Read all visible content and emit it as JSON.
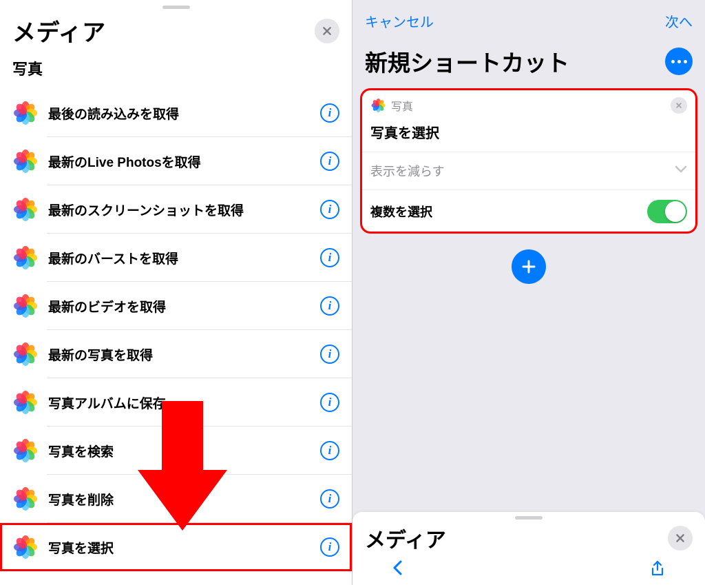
{
  "left": {
    "title": "メディア",
    "section": "写真",
    "items": [
      "最後の読み込みを取得",
      "最新のLive Photosを取得",
      "最新のスクリーンショットを取得",
      "最新のバーストを取得",
      "最新のビデオを取得",
      "最新の写真を取得",
      "写真アルバムに保存",
      "写真を検索",
      "写真を削除",
      "写真を選択"
    ],
    "highlight_index": 9
  },
  "right": {
    "cancel": "キャンセル",
    "next": "次へ",
    "title": "新規ショートカット",
    "card": {
      "app_label": "写真",
      "action_title": "写真を選択",
      "show_less": "表示を減らす",
      "toggle_label": "複数を選択",
      "toggle_on": true
    },
    "bottom_sheet_title": "メディア"
  },
  "colors": {
    "petals": [
      "#ff3b30",
      "#ff9500",
      "#ffcc00",
      "#34c759",
      "#5ac8fa",
      "#007aff",
      "#5856d6",
      "#ff2d55"
    ]
  }
}
